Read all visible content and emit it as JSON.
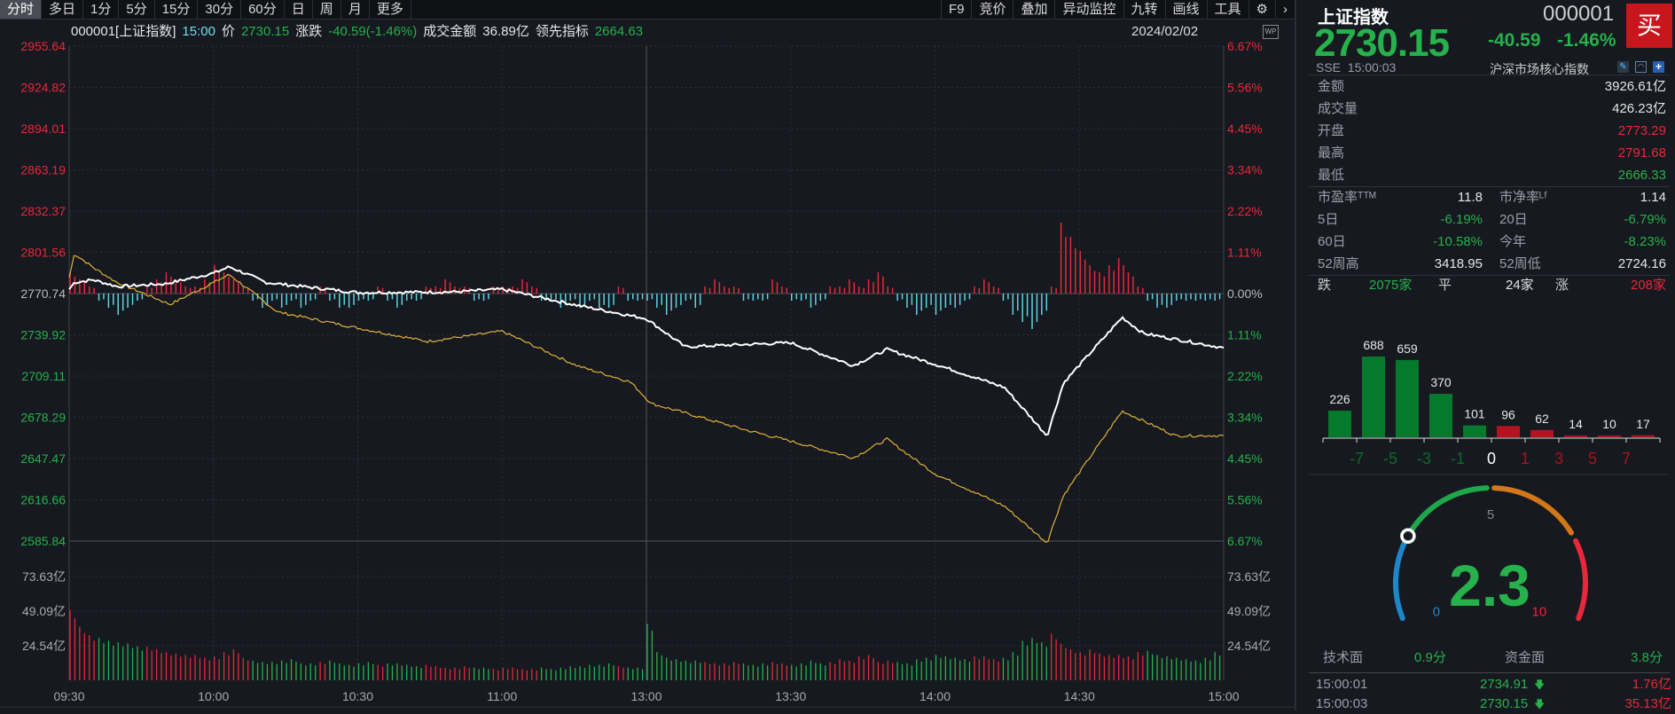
{
  "tabs": [
    "分时",
    "多日",
    "1分",
    "5分",
    "15分",
    "30分",
    "60分",
    "日",
    "周",
    "月",
    "更多"
  ],
  "tools": [
    "F9",
    "竞价",
    "叠加",
    "异动监控",
    "九转",
    "画线",
    "工具",
    "⚙",
    "›"
  ],
  "info": {
    "code": "000001[上证指数]",
    "time": "15:00",
    "price_label": "价",
    "price": "2730.15",
    "chg_label": "涨跌",
    "chg": "-40.59(-1.46%)",
    "amt_label": "成交金额",
    "amt": "36.89亿",
    "lead_label": "领先指标",
    "lead": "2664.63",
    "date": "2024/02/02",
    "wp": "WP"
  },
  "chart_data": {
    "type": "line",
    "price_ticks": [
      "2955.64",
      "2924.82",
      "2894.01",
      "2863.19",
      "2832.37",
      "2801.56",
      "2770.74",
      "2739.92",
      "2709.11",
      "2678.29",
      "2647.47",
      "2616.66",
      "2585.84"
    ],
    "pct_ticks": [
      "6.67%",
      "5.56%",
      "4.45%",
      "3.34%",
      "2.22%",
      "1.11%",
      "0.00%",
      "1.11%",
      "2.22%",
      "3.34%",
      "4.45%",
      "5.56%",
      "6.67%"
    ],
    "vol_ticks": [
      "73.63亿",
      "49.09亿",
      "24.54亿"
    ],
    "time_ticks": [
      "09:30",
      "10:00",
      "10:30",
      "11:00",
      "13:00",
      "13:30",
      "14:00",
      "14:30",
      "15:00"
    ],
    "prev_close": 2770.74,
    "ylim": [
      2585.84,
      2955.64
    ],
    "vol_max": 98.18,
    "index_line": [
      [
        0,
        2774
      ],
      [
        1.1,
        2779
      ],
      [
        5,
        2781
      ],
      [
        10,
        2776
      ],
      [
        20,
        2778
      ],
      [
        30,
        2786
      ],
      [
        33.3,
        2790.8
      ],
      [
        41,
        2779
      ],
      [
        60,
        2771.5
      ],
      [
        80,
        2772
      ],
      [
        90,
        2774
      ],
      [
        105.6,
        2762
      ],
      [
        120,
        2752
      ],
      [
        128,
        2731
      ],
      [
        150,
        2734
      ],
      [
        163,
        2717
      ],
      [
        170,
        2729
      ],
      [
        180,
        2718
      ],
      [
        194.4,
        2700.7
      ],
      [
        203.3,
        2664.5
      ],
      [
        206.7,
        2704
      ],
      [
        218.9,
        2753
      ],
      [
        223.3,
        2741
      ],
      [
        240,
        2730.15
      ]
    ],
    "lead_line": [
      [
        0,
        2782.8
      ],
      [
        1.1,
        2800.5
      ],
      [
        5.5,
        2789
      ],
      [
        10,
        2779
      ],
      [
        21,
        2762.7
      ],
      [
        30,
        2779
      ],
      [
        33.3,
        2785
      ],
      [
        43.3,
        2757
      ],
      [
        60,
        2745
      ],
      [
        74.4,
        2735
      ],
      [
        90,
        2742.6
      ],
      [
        105.6,
        2716.8
      ],
      [
        116.7,
        2704.7
      ],
      [
        121,
        2688.6
      ],
      [
        141,
        2668.5
      ],
      [
        150,
        2660.5
      ],
      [
        163,
        2648
      ],
      [
        170,
        2662
      ],
      [
        180,
        2636
      ],
      [
        194.4,
        2612
      ],
      [
        203.3,
        2584.5
      ],
      [
        206.7,
        2620
      ],
      [
        218.9,
        2683
      ],
      [
        230,
        2664.5
      ],
      [
        240,
        2664.63
      ]
    ],
    "strength": [
      3,
      2,
      1,
      -1,
      -2,
      -3,
      -2,
      -1,
      1,
      2,
      3,
      2,
      1,
      1,
      2,
      4,
      3,
      2,
      1,
      -1,
      -2,
      -1,
      -2,
      -1,
      -2,
      -1,
      1,
      -1,
      -2,
      -2,
      -1,
      -1,
      1,
      -1,
      -2,
      -1,
      -1,
      1,
      1,
      2,
      1,
      1,
      -1,
      -1,
      1,
      1,
      1,
      2,
      1,
      -1,
      -1,
      -2,
      -1,
      -2,
      -1,
      -2,
      -2,
      1,
      -1,
      -1,
      -1,
      -2,
      -3,
      -2,
      -1,
      -2,
      1,
      2,
      1,
      1,
      -1,
      -1,
      -1,
      2,
      1,
      -1,
      -1,
      -2,
      -1,
      1,
      1,
      2,
      1,
      2,
      3,
      1,
      -1,
      -2,
      -3,
      -2,
      -3,
      -2,
      -2,
      -1,
      1,
      2,
      1,
      -1,
      -3,
      -4,
      -5,
      -3,
      1,
      10,
      8,
      6,
      4,
      3,
      4,
      5,
      3,
      1,
      -1,
      -2,
      -2,
      -1,
      -1,
      -1,
      -1,
      -1
    ],
    "volume": [
      50,
      38,
      32,
      30,
      28,
      27,
      26,
      24,
      24,
      22,
      20,
      19,
      18,
      18,
      16,
      17,
      20,
      22,
      16,
      14,
      13,
      13,
      14,
      15,
      12,
      12,
      13,
      14,
      12,
      11,
      12,
      13,
      11,
      12,
      12,
      11,
      10,
      11,
      10,
      9,
      9,
      10,
      9,
      9,
      8,
      9,
      9,
      8,
      8,
      9,
      8,
      9,
      10,
      10,
      11,
      11,
      12,
      10,
      9,
      9,
      40,
      20,
      16,
      15,
      14,
      14,
      13,
      12,
      12,
      13,
      12,
      11,
      12,
      13,
      12,
      11,
      12,
      14,
      12,
      13,
      15,
      14,
      17,
      18,
      13,
      14,
      13,
      12,
      15,
      16,
      18,
      17,
      16,
      15,
      17,
      17,
      15,
      16,
      20,
      28,
      30,
      27,
      33,
      26,
      22,
      20,
      22,
      19,
      18,
      18,
      17,
      20,
      21,
      18,
      17,
      16,
      15,
      14,
      16,
      20
    ]
  },
  "panel": {
    "name": "上证指数",
    "code": "000001",
    "buy": "买",
    "price": "2730.15",
    "chg": "-40.59",
    "pct": "-1.46%",
    "exch": "SSE  15:00:03",
    "group": "沪深市场核心指数",
    "stats": [
      {
        "k": "金额",
        "v": "3926.61亿",
        "c": "w"
      },
      {
        "k": "成交量",
        "v": "426.23亿",
        "c": "w"
      },
      {
        "k": "开盘",
        "v": "2773.29",
        "c": "r"
      },
      {
        "k": "最高",
        "v": "2791.68",
        "c": "r"
      },
      {
        "k": "最低",
        "v": "2666.33",
        "c": "g"
      }
    ],
    "pairs": [
      [
        {
          "k": "市盈率ᵀᵀᴹ",
          "v": "11.8",
          "c": "w"
        },
        {
          "k": "市净率ᴸᶠ",
          "v": "1.14",
          "c": "w"
        }
      ],
      [
        {
          "k": "5日",
          "v": "-6.19%",
          "c": "g"
        },
        {
          "k": "20日",
          "v": "-6.79%",
          "c": "g"
        }
      ],
      [
        {
          "k": "60日",
          "v": "-10.58%",
          "c": "g"
        },
        {
          "k": "今年",
          "v": "-8.23%",
          "c": "g"
        }
      ],
      [
        {
          "k": "52周高",
          "v": "3418.95",
          "c": "w"
        },
        {
          "k": "52周低",
          "v": "2724.16",
          "c": "w"
        }
      ]
    ],
    "breadth": {
      "down_label": "跌",
      "down": "2075家",
      "flat_label": "平",
      "flat": "24家",
      "up_label": "涨",
      "up": "208家"
    },
    "dist": {
      "values": [
        226,
        688,
        659,
        370,
        101,
        96,
        62,
        14,
        10,
        17
      ],
      "colors": [
        "g",
        "g",
        "g",
        "g",
        "g",
        "r",
        "r",
        "r",
        "r",
        "r"
      ],
      "labels": [
        "-7",
        "-5",
        "-3",
        "-1",
        "0",
        "1",
        "3",
        "5",
        "7"
      ]
    },
    "gauge": {
      "value": 2.3,
      "display": "2.3",
      "min": "0",
      "mid": "5",
      "max": "10"
    },
    "scores": {
      "tech_label": "技术面",
      "tech": "0.9分",
      "fund_label": "资金面",
      "fund": "3.8分"
    },
    "ticks": [
      {
        "time": "15:00:01",
        "price": "2734.91",
        "arrow": "🡇",
        "amt": "1.76亿"
      },
      {
        "time": "15:00:03",
        "price": "2730.15",
        "arrow": "🡇",
        "amt": "35.13亿"
      }
    ]
  }
}
